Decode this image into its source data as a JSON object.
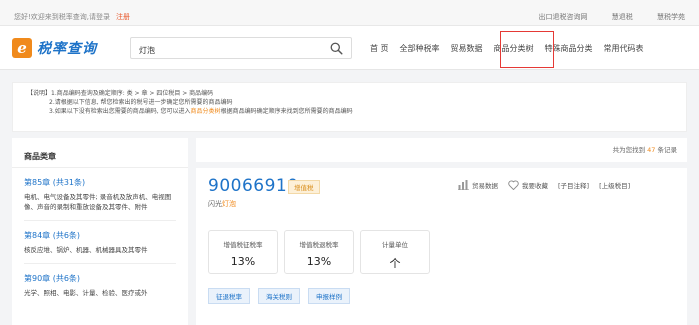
{
  "topbar": {
    "welcome": "您好!欢迎来到税率查询,请登录",
    "register": "注册",
    "links": [
      "出口退税咨询网",
      "慧退税",
      "慧税学苑"
    ]
  },
  "logo": {
    "mark": "e",
    "text": "税率查询"
  },
  "search": {
    "value": "灯泡"
  },
  "nav": [
    "首 页",
    "全部种税率",
    "贸易数据",
    "商品分类树",
    "特殊商品分类",
    "常用代码表"
  ],
  "notice": {
    "line1": "【说明】1.商品编码查询及确定顺序: 类 > 章 > 四位税目 > 商品编码",
    "line2": "2.请根据以下信息, 帮您检索出的税号进一步确定您所需要的商品编码",
    "line3_prefix": "3.如果以下没有检索出您需要的商品编码, 您可以进入",
    "line3_link": "商品分类树",
    "line3_suffix": "根据商品编码确定顺序来找到您所需要的商品编码"
  },
  "sidebar": {
    "title": "商品类章",
    "categories": [
      {
        "chapter": "第85章 (共31条)",
        "desc": "电机、电气设备及其零件; 录音机及放声机、电视图像、声音的录制和重放设备及其零件、附件"
      },
      {
        "chapter": "第84章 (共6条)",
        "desc": "核反应堆、锅炉、机器、机械器具及其零件"
      },
      {
        "chapter": "第90章 (共6条)",
        "desc": "光学、照相、电影、计量、检验、医疗或外"
      }
    ]
  },
  "results": {
    "prefix": "共为您找到",
    "count": "47",
    "suffix": "条记录"
  },
  "card": {
    "code": "90066910",
    "badge": "增值税",
    "name_prefix": "闪光",
    "name_highlight": "灯泡",
    "actions": [
      "贸易数据",
      "我要收藏",
      "[子目注释]",
      "[上级税目]"
    ],
    "metrics": [
      {
        "label": "增值税征税率",
        "value": "13%"
      },
      {
        "label": "增值税退税率",
        "value": "13%"
      },
      {
        "label": "计量单位",
        "value": "个"
      }
    ],
    "tags": [
      "征退税率",
      "海关税则",
      "申报样例"
    ]
  },
  "colors": {
    "brand_blue": "#1e73c8",
    "brand_orange": "#f08a1c",
    "highlight_red": "#e53935"
  }
}
